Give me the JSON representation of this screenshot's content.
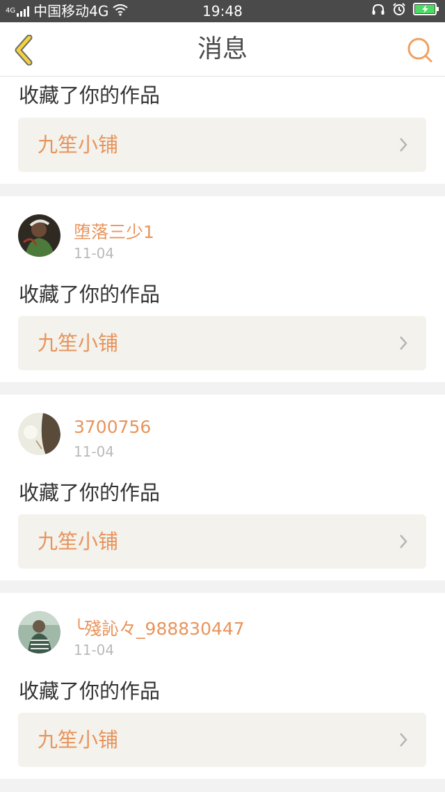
{
  "status_bar": {
    "network_badge": "4G",
    "carrier": "中国移动4G",
    "time": "19:48",
    "icons": [
      "signal-icon",
      "wifi-icon",
      "headset-icon",
      "alarm-icon",
      "battery-charging-icon"
    ]
  },
  "header": {
    "title": "消息",
    "back_icon": "chevron-left-icon",
    "search_icon": "search-icon",
    "accent_color": "#f0a060"
  },
  "messages": [
    {
      "action": "收藏了你的作品",
      "work_title": "九笙小铺"
    },
    {
      "username": "堕落三少1",
      "date": "11-04",
      "action": "收藏了你的作品",
      "work_title": "九笙小铺"
    },
    {
      "username": "3700756",
      "date": "11-04",
      "action": "收藏了你的作品",
      "work_title": "九笙小铺"
    },
    {
      "username": "╰殘訫々_988830447",
      "date": "11-04",
      "action": "收藏了你的作品",
      "work_title": "九笙小铺"
    }
  ],
  "colors": {
    "username": "#e8945c",
    "work_box_bg": "#f3f2ed",
    "date": "#b9b9b9",
    "page_bg": "#f2f2f2"
  }
}
